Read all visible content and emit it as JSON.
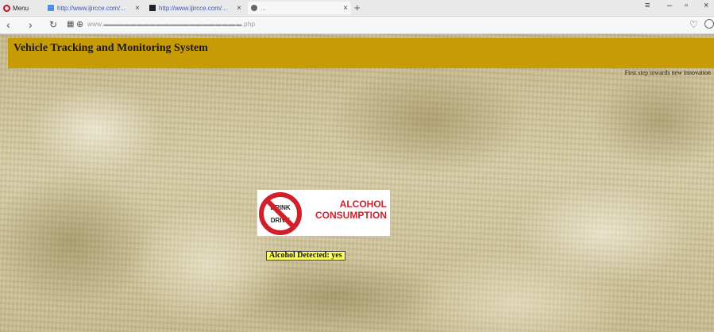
{
  "browser": {
    "menu_label": "Menu",
    "tabs": [
      {
        "title": "http://www.ijircce.com/..."
      },
      {
        "title": "http://www.ijircce.com/..."
      },
      {
        "title": "..."
      }
    ],
    "url": "www.▬▬▬▬▬▬▬▬▬▬▬▬▬▬▬▬▬▬▬▬▬.php"
  },
  "page": {
    "site_title": "Vehicle Tracking and Monitoring System",
    "tagline": "First step towards new innovation",
    "sign": {
      "circle_top": "DRINK",
      "circle_bottom": "DRIVE",
      "line1": "ALCOHOL",
      "line2": "CONSUMPTION"
    },
    "status_text": "Alcohol Detected: yes"
  },
  "colors": {
    "header_band": "#c79b05",
    "sign_red": "#d0202a",
    "status_bg": "#ffff66"
  }
}
